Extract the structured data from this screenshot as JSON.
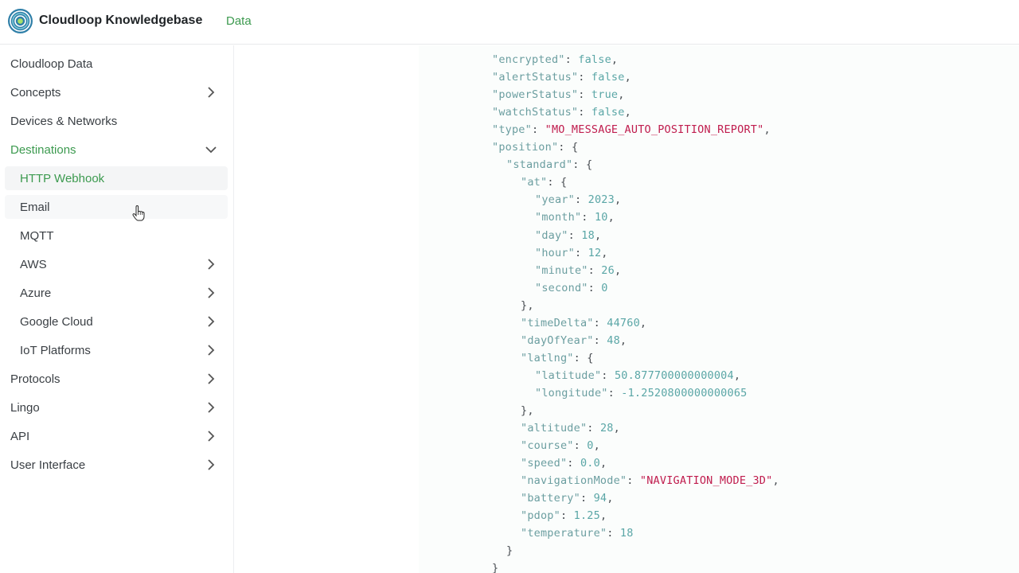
{
  "header": {
    "brand": "Cloudloop Knowledgebase",
    "nav_data": "Data",
    "logo_icon": "cloudloop-spiral-logo",
    "accent_color": "#3c9a4f"
  },
  "sidebar": {
    "items": [
      {
        "label": "Cloudloop Data"
      },
      {
        "label": "Concepts",
        "chevron": "right"
      },
      {
        "label": "Devices & Networks"
      },
      {
        "label": "Destinations",
        "chevron": "down",
        "active": true
      },
      {
        "label": "HTTP Webhook",
        "active": true
      },
      {
        "label": "Email"
      },
      {
        "label": "MQTT"
      },
      {
        "label": "AWS",
        "chevron": "right"
      },
      {
        "label": "Azure",
        "chevron": "right"
      },
      {
        "label": "Google Cloud",
        "chevron": "right"
      },
      {
        "label": "IoT Platforms",
        "chevron": "right"
      },
      {
        "label": "Protocols",
        "chevron": "right"
      },
      {
        "label": "Lingo",
        "chevron": "right"
      },
      {
        "label": "API",
        "chevron": "right"
      },
      {
        "label": "User Interface",
        "chevron": "right"
      }
    ]
  },
  "code": {
    "lines": [
      [
        "\"encrypted\"",
        ": ",
        "false",
        ","
      ],
      [
        "\"alertStatus\"",
        ": ",
        "false",
        ","
      ],
      [
        "\"powerStatus\"",
        ": ",
        "true",
        ","
      ],
      [
        "\"watchStatus\"",
        ": ",
        "false",
        ","
      ],
      [
        "\"type\"",
        ": ",
        "\"MO_MESSAGE_AUTO_POSITION_REPORT\"",
        ","
      ],
      [
        "\"position\"",
        ": ",
        "{",
        ""
      ],
      [
        "\"standard\"",
        ": ",
        "{",
        ""
      ],
      [
        "\"at\"",
        ": ",
        "{",
        ""
      ],
      [
        "\"year\"",
        ": ",
        "2023",
        ","
      ],
      [
        "\"month\"",
        ": ",
        "10",
        ","
      ],
      [
        "\"day\"",
        ": ",
        "18",
        ","
      ],
      [
        "\"hour\"",
        ": ",
        "12",
        ","
      ],
      [
        "\"minute\"",
        ": ",
        "26",
        ","
      ],
      [
        "\"second\"",
        ": ",
        "0",
        ""
      ],
      [
        "",
        "",
        "},",
        ""
      ],
      [
        "\"timeDelta\"",
        ": ",
        "44760",
        ","
      ],
      [
        "\"dayOfYear\"",
        ": ",
        "48",
        ","
      ],
      [
        "\"latlng\"",
        ": ",
        "{",
        ""
      ],
      [
        "\"latitude\"",
        ": ",
        "50.877700000000004",
        ","
      ],
      [
        "\"longitude\"",
        ": ",
        "-1.2520800000000065",
        ""
      ],
      [
        "",
        "",
        "},",
        ""
      ],
      [
        "\"altitude\"",
        ": ",
        "28",
        ","
      ],
      [
        "\"course\"",
        ": ",
        "0",
        ","
      ],
      [
        "\"speed\"",
        ": ",
        "0.0",
        ","
      ],
      [
        "\"navigationMode\"",
        ": ",
        "\"NAVIGATION_MODE_3D\"",
        ","
      ],
      [
        "\"battery\"",
        ": ",
        "94",
        ","
      ],
      [
        "\"pdop\"",
        ": ",
        "1.25",
        ","
      ],
      [
        "\"temperature\"",
        ": ",
        "18",
        ""
      ],
      [
        "",
        "",
        "}",
        ""
      ],
      [
        "",
        "",
        "}",
        ""
      ]
    ]
  }
}
